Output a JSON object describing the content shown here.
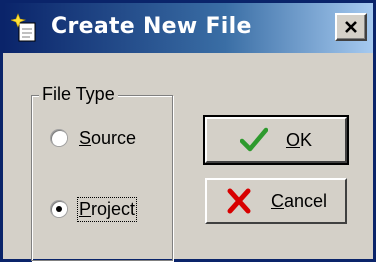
{
  "window": {
    "title": "Create New File",
    "app_icon": "sparkle-document-icon",
    "close_icon": "close-icon"
  },
  "file_type": {
    "group_label": "File Type",
    "options": [
      {
        "label_mnemonic": "S",
        "label_rest": "ource",
        "selected": false
      },
      {
        "label_mnemonic": "P",
        "label_rest": "roject",
        "selected": true
      }
    ]
  },
  "buttons": {
    "ok": {
      "mnemonic": "O",
      "rest": "K",
      "icon": "checkmark-icon",
      "icon_color": "#2e9a2e"
    },
    "cancel": {
      "mnemonic": "C",
      "rest": "ancel",
      "icon": "x-icon",
      "icon_color": "#d80000"
    }
  },
  "colors": {
    "titlebar_start": "#0a246a",
    "titlebar_end": "#a6caf0",
    "face": "#d4d0c8"
  }
}
